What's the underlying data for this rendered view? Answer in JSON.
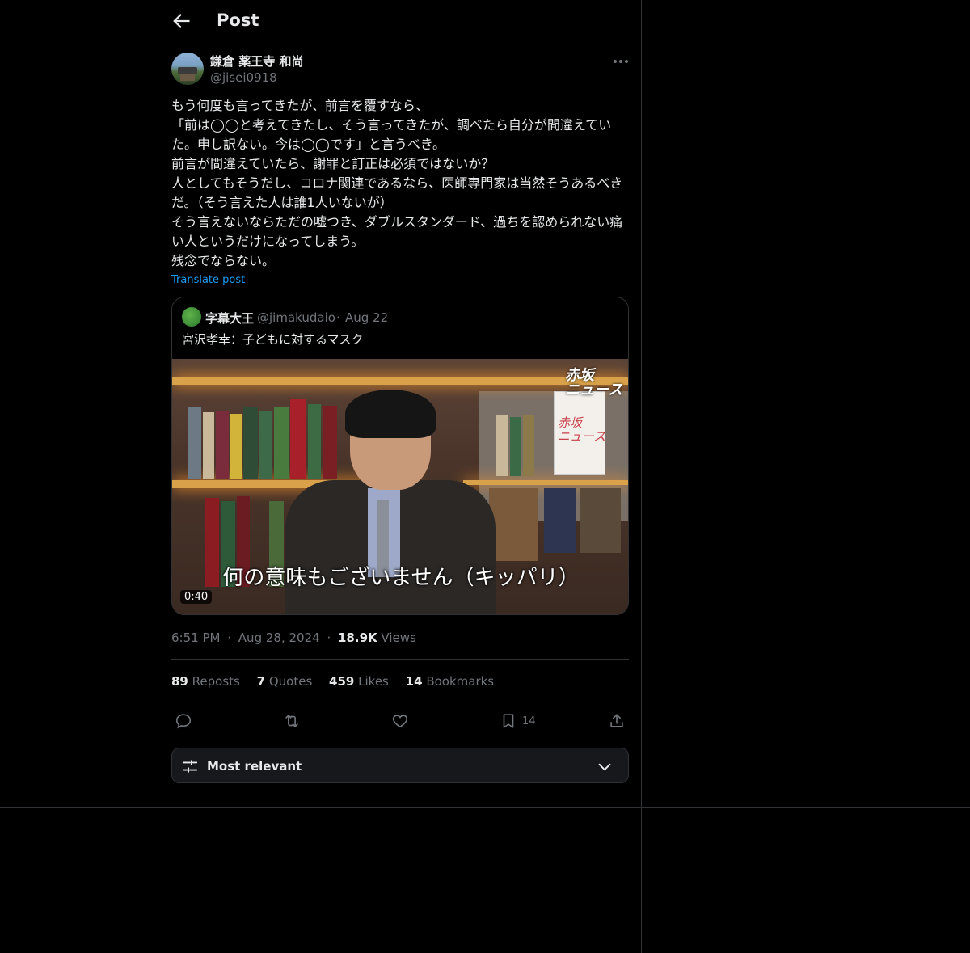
{
  "header": {
    "title": "Post"
  },
  "author": {
    "display_name": "鎌倉 薬王寺 和尚",
    "handle": "@jisei0918"
  },
  "post": {
    "text": "もう何度も言ってきたが、前言を覆すなら、\n「前は◯◯と考えてきたし、そう言ってきたが、調べたら自分が間違えていた。申し訳ない。今は◯◯です」と言うべき。\n前言が間違えていたら、謝罪と訂正は必須ではないか？\n人としてもそうだし、コロナ関連であるなら、医師専門家は当然そうあるべきだ。（そう言えた人は誰1人いないが）\nそう言えないならただの嘘つき、ダブルスタンダード、過ちを認められない痛い人というだけになってしまう。\n残念でならない。",
    "translate_label": "Translate post"
  },
  "quote": {
    "display_name": "字幕大王",
    "handle": "@jimakudaio",
    "separator": "·",
    "date": "Aug 22",
    "text": "宮沢孝幸：子どもに対するマスク",
    "video": {
      "subtitle": "何の意味もございません（キッパリ）",
      "duration": "0:40",
      "logo": "赤坂\nニュース",
      "sign_text": "赤坂\nニュース"
    }
  },
  "meta": {
    "time": "6:51 PM",
    "separator": "·",
    "date": "Aug 28, 2024",
    "views_count": "18.9K",
    "views_label": "Views"
  },
  "stats": [
    {
      "count": "89",
      "label": "Reposts"
    },
    {
      "count": "7",
      "label": "Quotes"
    },
    {
      "count": "459",
      "label": "Likes"
    },
    {
      "count": "14",
      "label": "Bookmarks"
    }
  ],
  "actions": {
    "bookmark_count": "14"
  },
  "sort": {
    "label": "Most relevant"
  },
  "colors": {
    "background": "#000000",
    "border": "#2f3336",
    "text": "#e7e9ea",
    "muted": "#71767b",
    "link": "#1d9bf0"
  }
}
